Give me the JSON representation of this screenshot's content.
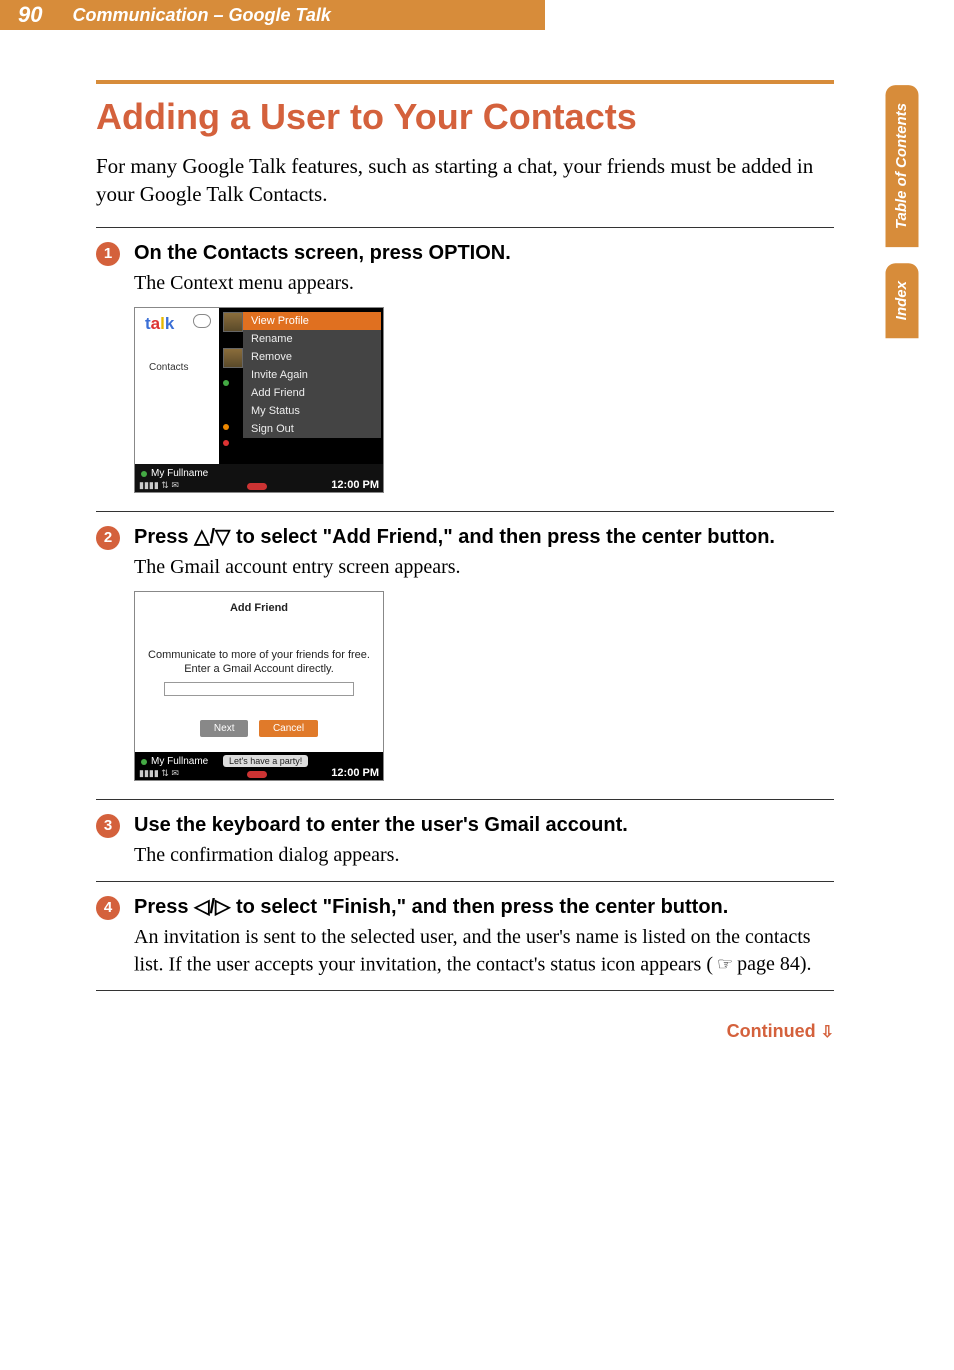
{
  "header": {
    "page_number": "90",
    "section": "Communication – Google Talk"
  },
  "tabs": {
    "toc": "Table of\nContents",
    "index": "Index"
  },
  "title": "Adding a User to Your Contacts",
  "intro": "For many Google Talk features, such as starting a chat, your friends must be added in your Google Talk Contacts.",
  "steps": [
    {
      "num": "1",
      "title": "On the Contacts screen, press OPTION.",
      "desc": "The Context menu appears."
    },
    {
      "num": "2",
      "title_a": "Press ",
      "title_arrows": "△/▽",
      "title_b": " to select \"Add Friend,\" and then press the center button.",
      "desc": "The Gmail account entry screen appears."
    },
    {
      "num": "3",
      "title": "Use the keyboard to enter the user's Gmail account.",
      "desc": "The confirmation dialog appears."
    },
    {
      "num": "4",
      "title_a": "Press ",
      "title_arrows": "◁/▷",
      "title_b": " to select \"Finish,\" and then press the center button.",
      "desc_a": "An invitation is sent to the selected user, and the user's name is listed on the contacts list. If the user accepts your invitation, the contact's status icon appears (",
      "desc_b": " page 84)."
    }
  ],
  "screenshot1": {
    "logo": "talk",
    "left_label": "Contacts",
    "menu": [
      "View Profile",
      "Rename",
      "Remove",
      "Invite Again",
      "Add Friend",
      "My Status",
      "Sign Out"
    ],
    "status_name": "My Fullname",
    "clock": "12:00 PM"
  },
  "screenshot2": {
    "title": "Add Friend",
    "message": "Communicate to more of your friends for free. Enter a Gmail Account directly.",
    "btn_next": "Next",
    "btn_cancel": "Cancel",
    "status_name": "My Fullname",
    "status_msg": "Let's have a party!",
    "clock": "12:00 PM"
  },
  "continued": "Continued",
  "hand_icon": "☞"
}
